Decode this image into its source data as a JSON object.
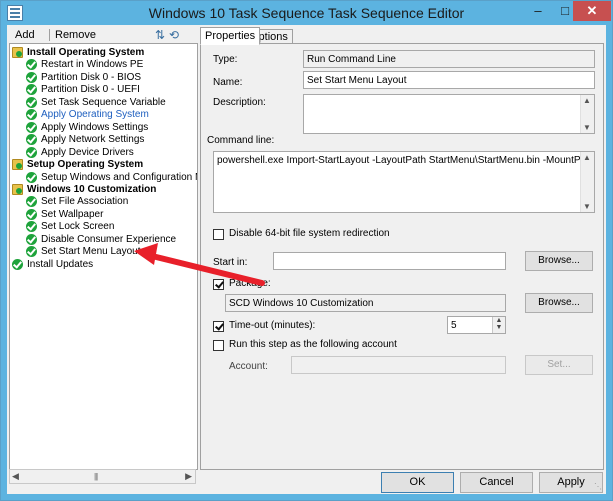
{
  "window": {
    "title": "Windows 10 Task Sequence Task Sequence Editor"
  },
  "toolbar": {
    "add": "Add",
    "add_arrow": "▾",
    "remove": "Remove",
    "icons": "⇅⟲"
  },
  "tree": [
    {
      "label": "Install Operating System",
      "kind": "group"
    },
    {
      "label": "Restart in Windows PE",
      "kind": "item"
    },
    {
      "label": "Partition Disk 0 - BIOS",
      "kind": "item"
    },
    {
      "label": "Partition Disk 0 - UEFI",
      "kind": "item"
    },
    {
      "label": "Set Task Sequence Variable",
      "kind": "item"
    },
    {
      "label": "Apply Operating System",
      "kind": "item",
      "selected_style": true
    },
    {
      "label": "Apply Windows Settings",
      "kind": "item"
    },
    {
      "label": "Apply Network Settings",
      "kind": "item"
    },
    {
      "label": "Apply Device Drivers",
      "kind": "item"
    },
    {
      "label": "Setup Operating System",
      "kind": "group"
    },
    {
      "label": "Setup Windows and Configuration Mar",
      "kind": "item"
    },
    {
      "label": "Windows 10 Customization",
      "kind": "group"
    },
    {
      "label": "Set File Association",
      "kind": "item"
    },
    {
      "label": "Set Wallpaper",
      "kind": "item"
    },
    {
      "label": "Set Lock Screen",
      "kind": "item"
    },
    {
      "label": "Disable Consumer Experience",
      "kind": "item"
    },
    {
      "label": "Set Start Menu Layout",
      "kind": "item"
    },
    {
      "label": "Install Updates",
      "kind": "item"
    }
  ],
  "tabs": {
    "properties": "Properties",
    "options": "Options"
  },
  "props": {
    "type_label": "Type:",
    "type_value": "Run Command Line",
    "name_label": "Name:",
    "name_value": "Set Start Menu Layout",
    "description_label": "Description:",
    "description_value": "",
    "command_line_label": "Command line:",
    "command_line_value": "powershell.exe Import-StartLayout -LayoutPath StartMenu\\StartMenu.bin -MountPath C:\\",
    "disable_64bit_label": "Disable 64-bit file system redirection",
    "start_in_label": "Start in:",
    "start_in_value": "",
    "browse_label": "Browse...",
    "package_label": "Package:",
    "package_value": "SCD Windows 10 Customization",
    "timeout_label": "Time-out (minutes):",
    "timeout_value": "5",
    "run_as_label": "Run this step as the following account",
    "account_label": "Account:",
    "account_value": "",
    "set_label": "Set..."
  },
  "checks": {
    "disable_64bit": false,
    "package": true,
    "timeout": true,
    "run_as": false
  },
  "buttons": {
    "ok": "OK",
    "cancel": "Cancel",
    "apply": "Apply"
  },
  "colors": {
    "titlebar": "#5cb3e0",
    "close": "#c75050",
    "annotation_arrow": "#e8202a",
    "check_icon": "#1ea33b"
  }
}
